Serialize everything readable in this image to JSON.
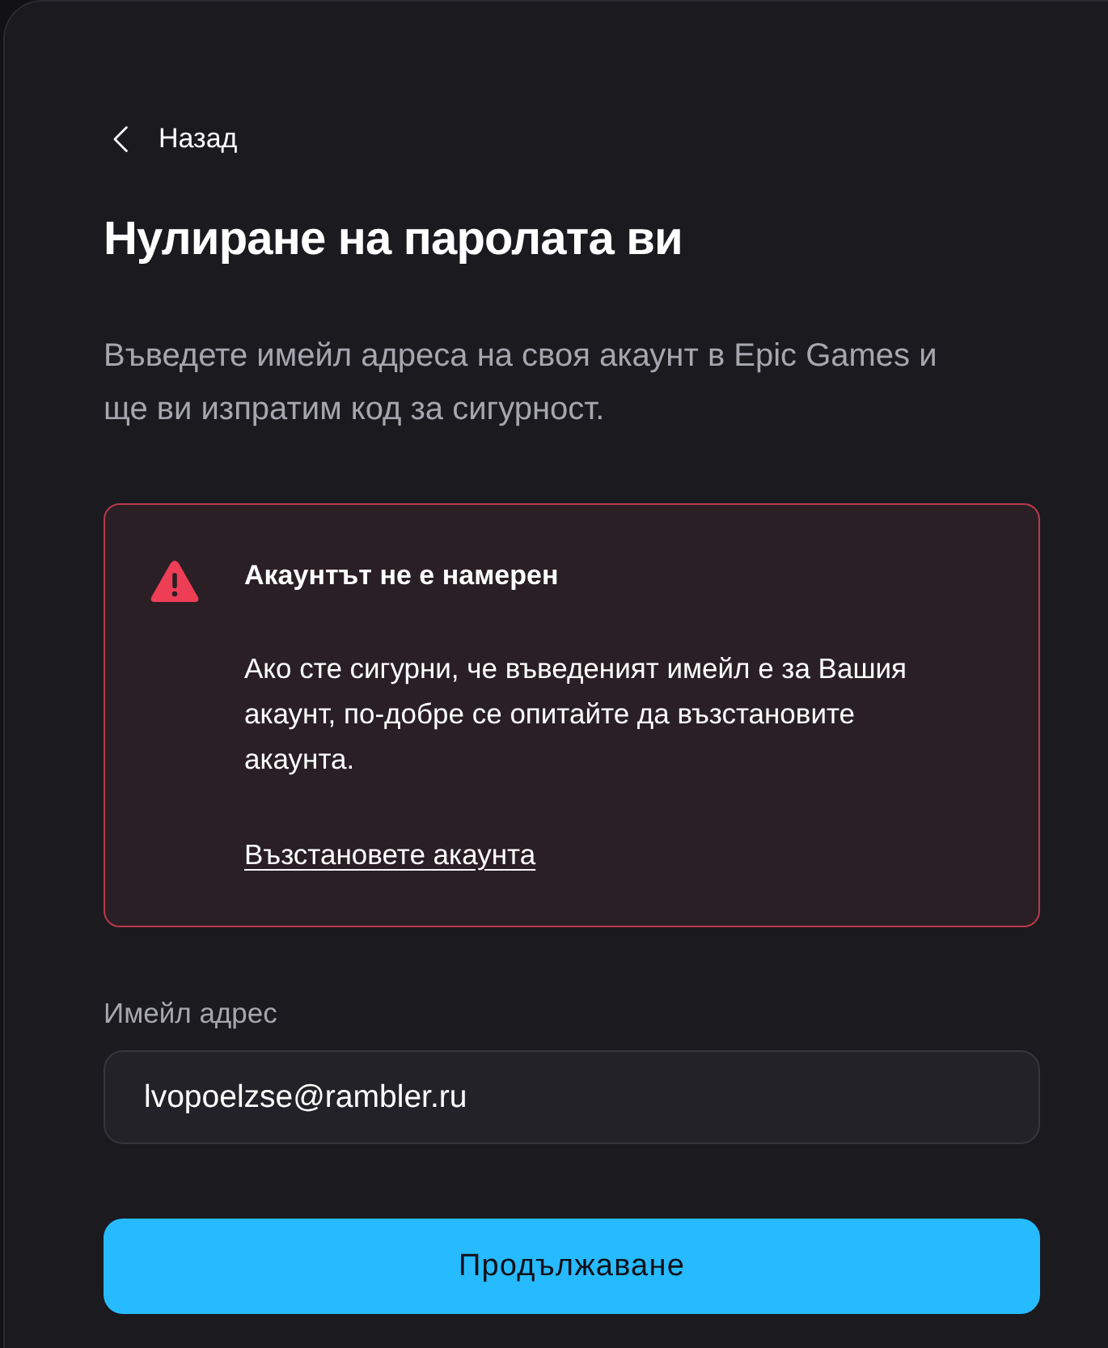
{
  "back_link": {
    "label": "Назад"
  },
  "title": "Нулиране на паролата ви",
  "description": "Въведете имейл адреса на своя акаунт в Epic Games и ще ви изпратим код за сигурност.",
  "alert": {
    "kind": "error",
    "title": "Акаунтът не е намерен",
    "message": "Ако сте сигурни, че въведеният имейл е за Вашия акаунт, по-добре се опитайте да възстановите акаунта.",
    "link": "Възстановете акаунта"
  },
  "email_field": {
    "label": "Имейл адрес",
    "value": "lvopoelzse@rambler.ru"
  },
  "submit_button": {
    "label": "Продължаване"
  }
}
